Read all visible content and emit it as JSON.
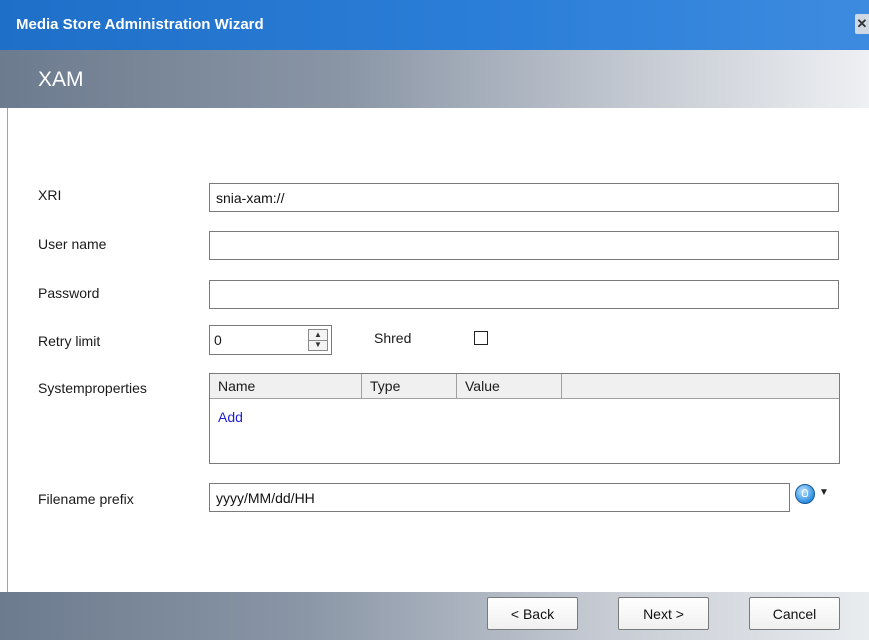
{
  "window": {
    "title": "Media Store Administration Wizard",
    "close_glyph": "✕"
  },
  "header": {
    "subtitle": "XAM"
  },
  "form": {
    "xri": {
      "label": "XRI",
      "value": "snia-xam://"
    },
    "user_name": {
      "label": "User name",
      "value": ""
    },
    "password": {
      "label": "Password",
      "value": ""
    },
    "retry_limit": {
      "label": "Retry limit",
      "value": "0"
    },
    "shred": {
      "label": "Shred",
      "checked": false
    },
    "system_properties": {
      "label": "Systemproperties",
      "columns": [
        "Name",
        "Type",
        "Value"
      ],
      "add_label": "Add"
    },
    "filename_prefix": {
      "label": "Filename prefix",
      "value": "yyyy/MM/dd/HH",
      "icon": "lightbulb-icon"
    }
  },
  "buttons": {
    "back": "< Back",
    "next": "Next >",
    "cancel": "Cancel"
  }
}
